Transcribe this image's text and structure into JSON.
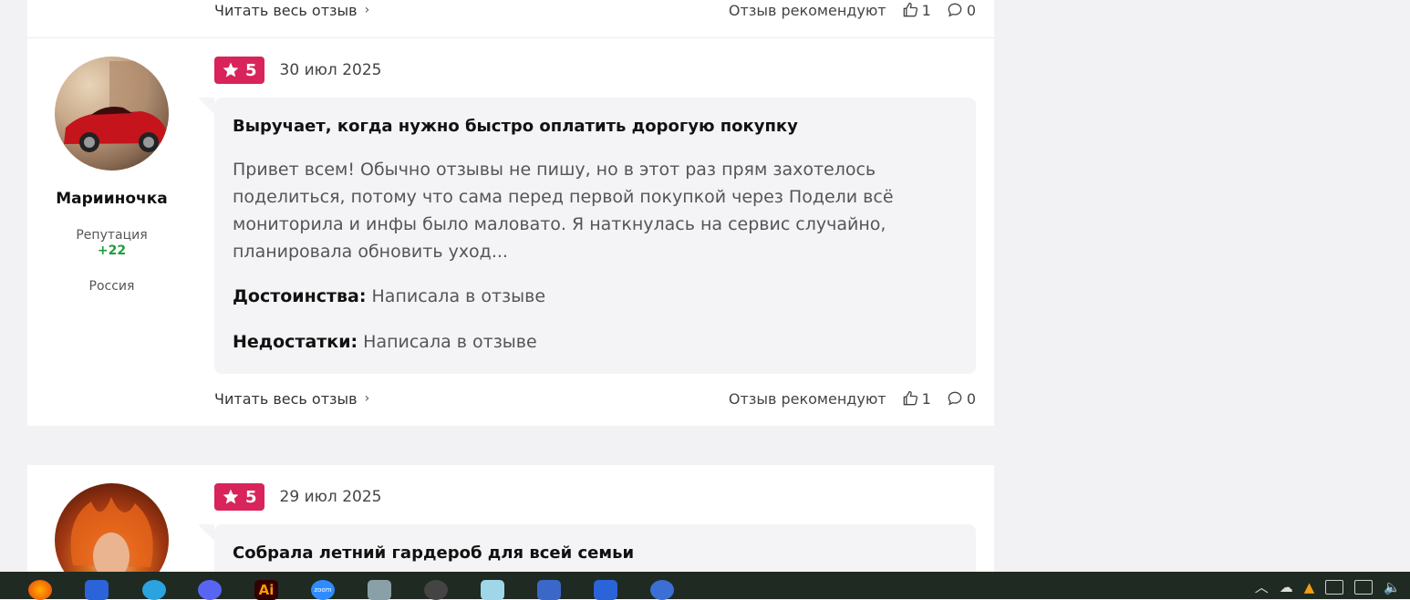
{
  "top_card": {
    "read_more": "Читать весь отзыв",
    "recommend": "Отзыв рекомендуют",
    "likes": "1",
    "comments": "0"
  },
  "review": {
    "user_name": "Марииночка",
    "reputation_label": "Репутация",
    "reputation_value": "+22",
    "country": "Россия",
    "rating": "5",
    "date": "30 июл 2025",
    "title": "Выручает, когда нужно быстро оплатить дорогую покупку",
    "text": "Привет всем! Обычно отзывы не пишу, но в этот раз прям захотелось поделиться, потому что сама перед первой покупкой через Подели всё мониторила и инфы было маловато. Я наткнулась на сервис случайно, планировала обновить уход...",
    "pros_label": "Достоинства:",
    "pros": "Написала в отзыве",
    "cons_label": "Недостатки:",
    "cons": "Написала в отзыве",
    "read_more": "Читать весь отзыв",
    "recommend": "Отзыв рекомендуют",
    "likes": "1",
    "comments": "0"
  },
  "next_review": {
    "rating": "5",
    "date": "29 июл 2025",
    "title": "Собрала летний гардероб для всей семьи"
  },
  "taskbar": {
    "apps": [
      "firefox-icon",
      "maxthon-icon",
      "telegram-icon",
      "discord-icon",
      "illustrator-icon",
      "zoom-icon",
      "calculator-icon",
      "app-icon",
      "files-icon",
      "network-icon",
      "maxthon-icon",
      "screen-icon"
    ],
    "illustrator_label": "Ai",
    "zoom_label": "zoom"
  },
  "colors": {
    "badge": "#d8245a",
    "reputation": "#1f9d3a",
    "bubble": "#f4f4f6",
    "taskbar": "#1f2a22"
  }
}
